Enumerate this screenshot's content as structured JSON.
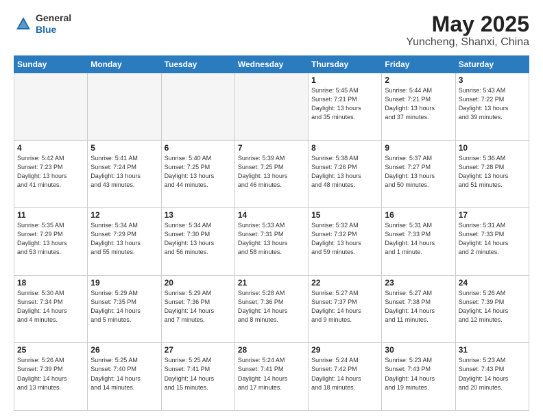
{
  "header": {
    "logo_general": "General",
    "logo_blue": "Blue",
    "title": "May 2025",
    "subtitle": "Yuncheng, Shanxi, China"
  },
  "calendar": {
    "days_of_week": [
      "Sunday",
      "Monday",
      "Tuesday",
      "Wednesday",
      "Thursday",
      "Friday",
      "Saturday"
    ],
    "weeks": [
      [
        {
          "day": "",
          "info": ""
        },
        {
          "day": "",
          "info": ""
        },
        {
          "day": "",
          "info": ""
        },
        {
          "day": "",
          "info": ""
        },
        {
          "day": "1",
          "info": "Sunrise: 5:45 AM\nSunset: 7:21 PM\nDaylight: 13 hours\nand 35 minutes."
        },
        {
          "day": "2",
          "info": "Sunrise: 5:44 AM\nSunset: 7:21 PM\nDaylight: 13 hours\nand 37 minutes."
        },
        {
          "day": "3",
          "info": "Sunrise: 5:43 AM\nSunset: 7:22 PM\nDaylight: 13 hours\nand 39 minutes."
        }
      ],
      [
        {
          "day": "4",
          "info": "Sunrise: 5:42 AM\nSunset: 7:23 PM\nDaylight: 13 hours\nand 41 minutes."
        },
        {
          "day": "5",
          "info": "Sunrise: 5:41 AM\nSunset: 7:24 PM\nDaylight: 13 hours\nand 43 minutes."
        },
        {
          "day": "6",
          "info": "Sunrise: 5:40 AM\nSunset: 7:25 PM\nDaylight: 13 hours\nand 44 minutes."
        },
        {
          "day": "7",
          "info": "Sunrise: 5:39 AM\nSunset: 7:25 PM\nDaylight: 13 hours\nand 46 minutes."
        },
        {
          "day": "8",
          "info": "Sunrise: 5:38 AM\nSunset: 7:26 PM\nDaylight: 13 hours\nand 48 minutes."
        },
        {
          "day": "9",
          "info": "Sunrise: 5:37 AM\nSunset: 7:27 PM\nDaylight: 13 hours\nand 50 minutes."
        },
        {
          "day": "10",
          "info": "Sunrise: 5:36 AM\nSunset: 7:28 PM\nDaylight: 13 hours\nand 51 minutes."
        }
      ],
      [
        {
          "day": "11",
          "info": "Sunrise: 5:35 AM\nSunset: 7:29 PM\nDaylight: 13 hours\nand 53 minutes."
        },
        {
          "day": "12",
          "info": "Sunrise: 5:34 AM\nSunset: 7:29 PM\nDaylight: 13 hours\nand 55 minutes."
        },
        {
          "day": "13",
          "info": "Sunrise: 5:34 AM\nSunset: 7:30 PM\nDaylight: 13 hours\nand 56 minutes."
        },
        {
          "day": "14",
          "info": "Sunrise: 5:33 AM\nSunset: 7:31 PM\nDaylight: 13 hours\nand 58 minutes."
        },
        {
          "day": "15",
          "info": "Sunrise: 5:32 AM\nSunset: 7:32 PM\nDaylight: 13 hours\nand 59 minutes."
        },
        {
          "day": "16",
          "info": "Sunrise: 5:31 AM\nSunset: 7:33 PM\nDaylight: 14 hours\nand 1 minute."
        },
        {
          "day": "17",
          "info": "Sunrise: 5:31 AM\nSunset: 7:33 PM\nDaylight: 14 hours\nand 2 minutes."
        }
      ],
      [
        {
          "day": "18",
          "info": "Sunrise: 5:30 AM\nSunset: 7:34 PM\nDaylight: 14 hours\nand 4 minutes."
        },
        {
          "day": "19",
          "info": "Sunrise: 5:29 AM\nSunset: 7:35 PM\nDaylight: 14 hours\nand 5 minutes."
        },
        {
          "day": "20",
          "info": "Sunrise: 5:29 AM\nSunset: 7:36 PM\nDaylight: 14 hours\nand 7 minutes."
        },
        {
          "day": "21",
          "info": "Sunrise: 5:28 AM\nSunset: 7:36 PM\nDaylight: 14 hours\nand 8 minutes."
        },
        {
          "day": "22",
          "info": "Sunrise: 5:27 AM\nSunset: 7:37 PM\nDaylight: 14 hours\nand 9 minutes."
        },
        {
          "day": "23",
          "info": "Sunrise: 5:27 AM\nSunset: 7:38 PM\nDaylight: 14 hours\nand 11 minutes."
        },
        {
          "day": "24",
          "info": "Sunrise: 5:26 AM\nSunset: 7:39 PM\nDaylight: 14 hours\nand 12 minutes."
        }
      ],
      [
        {
          "day": "25",
          "info": "Sunrise: 5:26 AM\nSunset: 7:39 PM\nDaylight: 14 hours\nand 13 minutes."
        },
        {
          "day": "26",
          "info": "Sunrise: 5:25 AM\nSunset: 7:40 PM\nDaylight: 14 hours\nand 14 minutes."
        },
        {
          "day": "27",
          "info": "Sunrise: 5:25 AM\nSunset: 7:41 PM\nDaylight: 14 hours\nand 15 minutes."
        },
        {
          "day": "28",
          "info": "Sunrise: 5:24 AM\nSunset: 7:41 PM\nDaylight: 14 hours\nand 17 minutes."
        },
        {
          "day": "29",
          "info": "Sunrise: 5:24 AM\nSunset: 7:42 PM\nDaylight: 14 hours\nand 18 minutes."
        },
        {
          "day": "30",
          "info": "Sunrise: 5:23 AM\nSunset: 7:43 PM\nDaylight: 14 hours\nand 19 minutes."
        },
        {
          "day": "31",
          "info": "Sunrise: 5:23 AM\nSunset: 7:43 PM\nDaylight: 14 hours\nand 20 minutes."
        }
      ]
    ]
  }
}
